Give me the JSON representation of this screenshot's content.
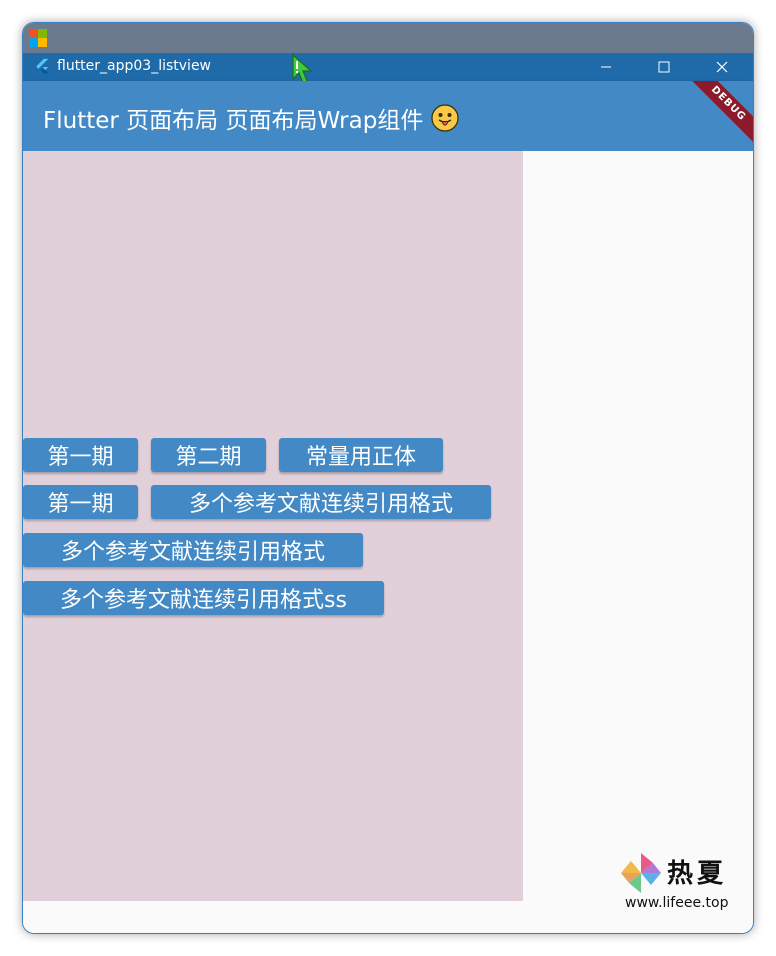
{
  "window": {
    "title": "flutter_app03_listview"
  },
  "app_bar": {
    "title": "Flutter 页面布局 页面布局Wrap组件",
    "emoji": "tongue-out-face",
    "debug_banner": "DEBUG"
  },
  "wrap": {
    "rows": [
      [
        "第一期",
        "第二期",
        "常量用正体"
      ],
      [
        "第一期",
        "多个参考文献连续引用格式"
      ],
      [
        "多个参考文献连续引用格式"
      ],
      [
        "多个参考文献连续引用格式ss"
      ]
    ]
  },
  "watermark": {
    "name": "热夏",
    "url": "www.lifeee.top"
  },
  "colors": {
    "app_bar": "#4289c6",
    "title_bar": "#1f6aa8",
    "chip": "#4289c6",
    "wrap_bg": "#e1d0da",
    "debug_ribbon": "#8b1a2a"
  }
}
